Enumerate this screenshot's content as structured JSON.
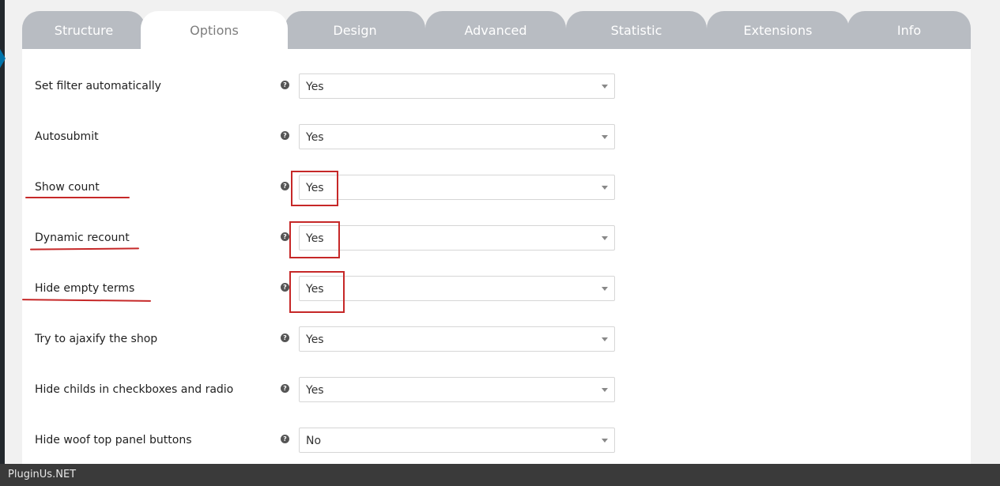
{
  "tabs": [
    {
      "label": "Structure",
      "active": false
    },
    {
      "label": "Options",
      "active": true
    },
    {
      "label": "Design",
      "active": false
    },
    {
      "label": "Advanced",
      "active": false
    },
    {
      "label": "Statistic",
      "active": false
    },
    {
      "label": "Extensions",
      "active": false
    },
    {
      "label": "Info",
      "active": false
    }
  ],
  "options": [
    {
      "label": "Set filter automatically",
      "value": "Yes"
    },
    {
      "label": "Autosubmit",
      "value": "Yes"
    },
    {
      "label": "Show count",
      "value": "Yes"
    },
    {
      "label": "Dynamic recount",
      "value": "Yes"
    },
    {
      "label": "Hide empty terms",
      "value": "Yes"
    },
    {
      "label": "Try to ajaxify the shop",
      "value": "Yes"
    },
    {
      "label": "Hide childs in checkboxes and radio",
      "value": "Yes"
    },
    {
      "label": "Hide woof top panel buttons",
      "value": "No"
    }
  ],
  "help_icon_glyph": "?",
  "highlighted_options": [
    "Show count",
    "Dynamic recount",
    "Hide empty terms"
  ],
  "annotation_color": "#c62828",
  "footer": {
    "text": "PluginUs.NET"
  }
}
